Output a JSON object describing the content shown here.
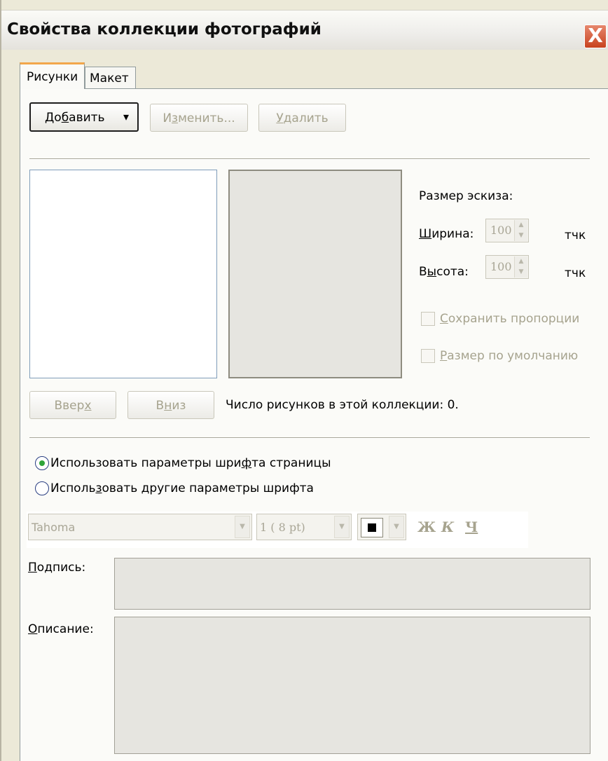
{
  "window": {
    "title": "Свойства коллекции фотографий",
    "close_glyph": "X"
  },
  "tabs": [
    {
      "label": "Рисунки",
      "active": true
    },
    {
      "label": "Макет",
      "active": false
    }
  ],
  "toolbar": {
    "add_label_pre": "До",
    "add_label_mnemonic": "б",
    "add_label_post": "авить",
    "add_dropdown_glyph": "▾",
    "edit_label_pre": "И",
    "edit_label_mnemonic": "з",
    "edit_label_post": "менить...",
    "delete_label_mnemonic": "У",
    "delete_label_post": "далить"
  },
  "thumbnail": {
    "heading": "Размер эскиза:",
    "width_label_mnemonic": "Ш",
    "width_label_post": "ирина:",
    "width_value": "100",
    "height_label_pre": "В",
    "height_label_mnemonic": "ы",
    "height_label_post": "сота:",
    "height_value": "100",
    "unit": "тчк",
    "keep_proportions_mnemonic": "С",
    "keep_proportions_post": "охранить пропорции",
    "default_size_mnemonic": "Р",
    "default_size_post": "азмер по умолчанию"
  },
  "order": {
    "up_label_pre": "Ввер",
    "up_label_mnemonic": "х",
    "down_label_pre": "В",
    "down_label_mnemonic": "н",
    "down_label_post": "из",
    "count_text": "Число рисунков в этой коллекции: 0."
  },
  "font": {
    "use_page_pre": "Использовать параметры шри",
    "use_page_mnemonic": "ф",
    "use_page_post": "та страницы",
    "use_other_pre": "Исполь",
    "use_other_mnemonic": "з",
    "use_other_post": "овать другие параметры шрифта",
    "selected_option": "use_page",
    "font_name": "Tahoma",
    "font_size": "1  ( 8 pt)",
    "bold_glyph": "Ж",
    "italic_glyph": "К",
    "underline_glyph": "Ч"
  },
  "caption": {
    "label_mnemonic": "П",
    "label_post": "одпись:"
  },
  "description": {
    "label_mnemonic": "О",
    "label_post": "писание:"
  },
  "colors": {
    "active_tab_accent": "#f2a64a",
    "close_button": "#c8421f",
    "radio_dot": "#2fa43a"
  }
}
